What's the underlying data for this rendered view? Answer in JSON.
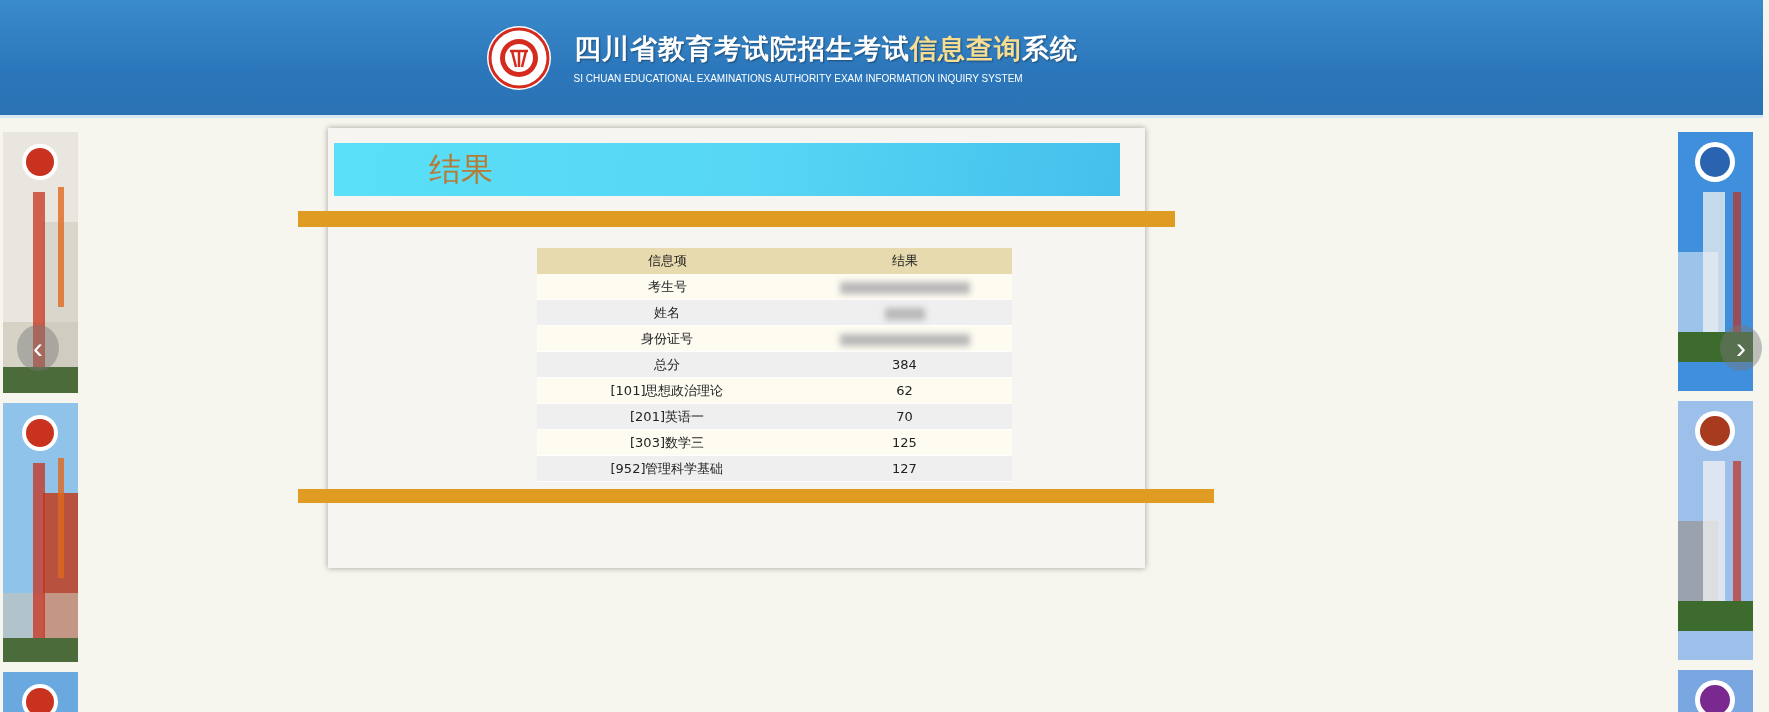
{
  "header": {
    "title_parts": [
      {
        "text": "四川省教育考试院招生考试",
        "highlight": false
      },
      {
        "text": "信息查询",
        "highlight": true
      },
      {
        "text": "系统",
        "highlight": false
      }
    ],
    "subtitle": "SI CHUAN EDUCATIONAL EXAMINATIONS AUTHORITY EXAM INFORMATION INQUIRY SYSTEM"
  },
  "carousel": {
    "prev": "‹",
    "next": "›"
  },
  "panel": {
    "title": "结果"
  },
  "table": {
    "columns": [
      "信息项",
      "结果"
    ],
    "rows": [
      {
        "item": "考生号",
        "blurred": true
      },
      {
        "item": "姓名",
        "blurred": true
      },
      {
        "item": "身份证号",
        "blurred": true
      },
      {
        "item": "总分",
        "value": "384",
        "blurred": false
      },
      {
        "item": "[101]思想政治理论",
        "value": "62",
        "blurred": false
      },
      {
        "item": "[201]英语一",
        "value": "70",
        "blurred": false
      },
      {
        "item": "[303]数学三",
        "value": "125",
        "blurred": false
      },
      {
        "item": "[952]管理科学基础",
        "value": "127",
        "blurred": false
      }
    ]
  }
}
